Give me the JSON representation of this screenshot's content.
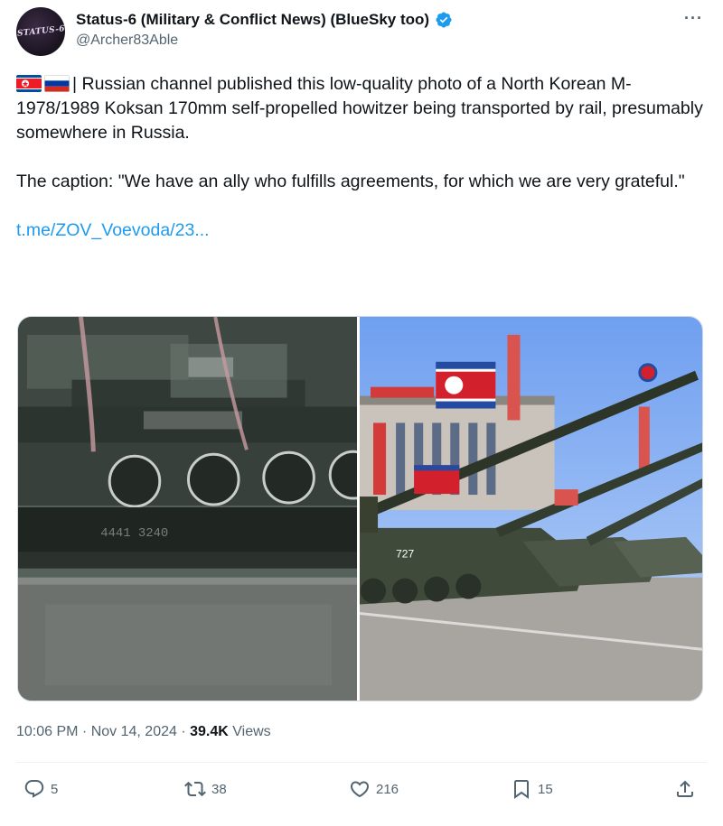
{
  "post": {
    "author": {
      "display_name": "Status-6 (Military & Conflict News) (BlueSky too)",
      "handle": "@Archer83Able",
      "avatar_text": "STATUS-6",
      "verified": true
    },
    "more_label": "···",
    "text": {
      "line1": "| Russian channel published this low-quality photo of a North Korean M-1978/1989 Koksan 170mm self-propelled howitzer being transported by rail, presumably somewhere in Russia.",
      "line2": "The caption: \"We have an ally who fulfills agreements, for which we are very grateful.\"",
      "link": "t.me/ZOV_Voevoda/23..."
    },
    "flags": [
      "north-korea-flag-icon",
      "russia-flag-icon"
    ],
    "media": {
      "left_marking": "4441  3240",
      "right_number": "727"
    },
    "timestamp": "10:06 PM · Nov 14, 2024 · ",
    "views_count": "39.4K",
    "views_label": " Views",
    "actions": {
      "replies": "5",
      "reposts": "38",
      "likes": "216",
      "bookmarks": "15"
    }
  },
  "colors": {
    "accent": "#1d9bf0",
    "text": "#0f1419",
    "secondary": "#536471"
  }
}
